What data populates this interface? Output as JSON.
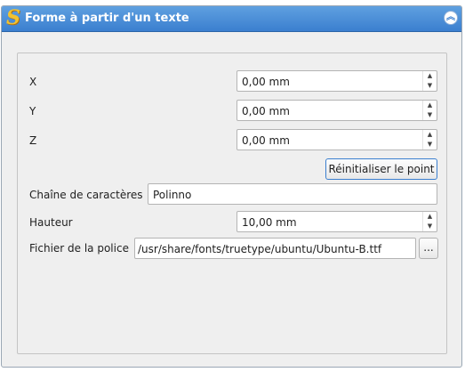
{
  "panel": {
    "title": "Forme à partir d'un texte",
    "icon": "freecad-logo-icon",
    "collapse_icon": "collapse-up-icon",
    "collapse_glyph": "︽"
  },
  "fields": {
    "x": {
      "label": "X",
      "value": "0,00 mm"
    },
    "y": {
      "label": "Y",
      "value": "0,00 mm"
    },
    "z": {
      "label": "Z",
      "value": "0,00 mm"
    },
    "reset_button": "Réinitialiser le point",
    "string": {
      "label": "Chaîne de caractères",
      "value": "Polinno"
    },
    "height": {
      "label": "Hauteur",
      "value": "10,00 mm"
    },
    "font_file": {
      "label": "Fichier de la police",
      "value": "/usr/share/fonts/truetype/ubuntu/Ubuntu-B.ttf",
      "browse": "..."
    }
  },
  "spin_glyphs": {
    "up": "▲",
    "down": "▼"
  },
  "colors": {
    "title_bar": "#3b7fcf",
    "panel_bg": "#efefef",
    "focus_border": "#3b7fcf"
  }
}
